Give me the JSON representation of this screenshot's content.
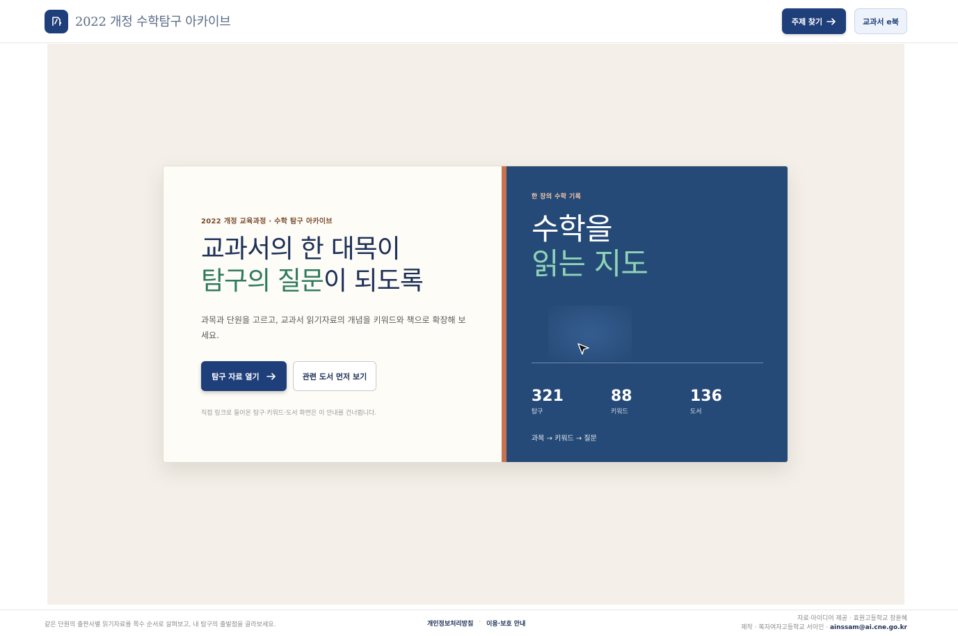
{
  "header": {
    "brand": "2022 개정 수학탐구 아카이브",
    "topic_button": "주제 찾기",
    "ebook_button": "교과서 e북"
  },
  "hero": {
    "eyebrow": "2022 개정 교육과정 · 수학 탐구 아카이브",
    "headline_line1": "교과서의 한 대목이",
    "headline_accent": "탐구의 질문",
    "headline_line2_rest": "이 되도록",
    "description": "과목과 단원을 고르고, 교과서 읽기자료의 개념을 키워드와 책으로 확장해 보세요.",
    "primary_button": "탐구 자료 열기",
    "secondary_button": "관련 도서 먼저 보기",
    "note": "직접 링크로 들어온 탐구·키워드·도서 화면은 이 안내를 건너뜁니다."
  },
  "panel": {
    "eyebrow": "한 장의 수학 기록",
    "title_line1": "수학을",
    "title_line2": "읽는 지도",
    "stats": [
      {
        "value": "321",
        "label": "탐구"
      },
      {
        "value": "88",
        "label": "키워드"
      },
      {
        "value": "136",
        "label": "도서"
      }
    ],
    "flow": "과목 → 키워드 → 질문"
  },
  "footer": {
    "left": "같은 단원의 출판사별 읽기자료를 쪽수 순서로 살펴보고, 내 탐구의 출발점을 골라보세요.",
    "privacy": "개인정보처리방침",
    "separator": "·",
    "usage": "이용·보호 안내",
    "credit_line1": "자료·아이디어 제공 · 효원고등학교 장윤혜",
    "credit_line2_prefix": "제작 · 복자여자고등학교 서이인 · ",
    "email": "ainssam@ai.cne.go.kr"
  },
  "colors": {
    "navy": "#1f3f7a",
    "panel": "#264a77",
    "accent_green": "#2f7a5e",
    "accent_mint": "#8fd4b8",
    "divider": "#c8734f",
    "stage": "#f4f0e9"
  }
}
